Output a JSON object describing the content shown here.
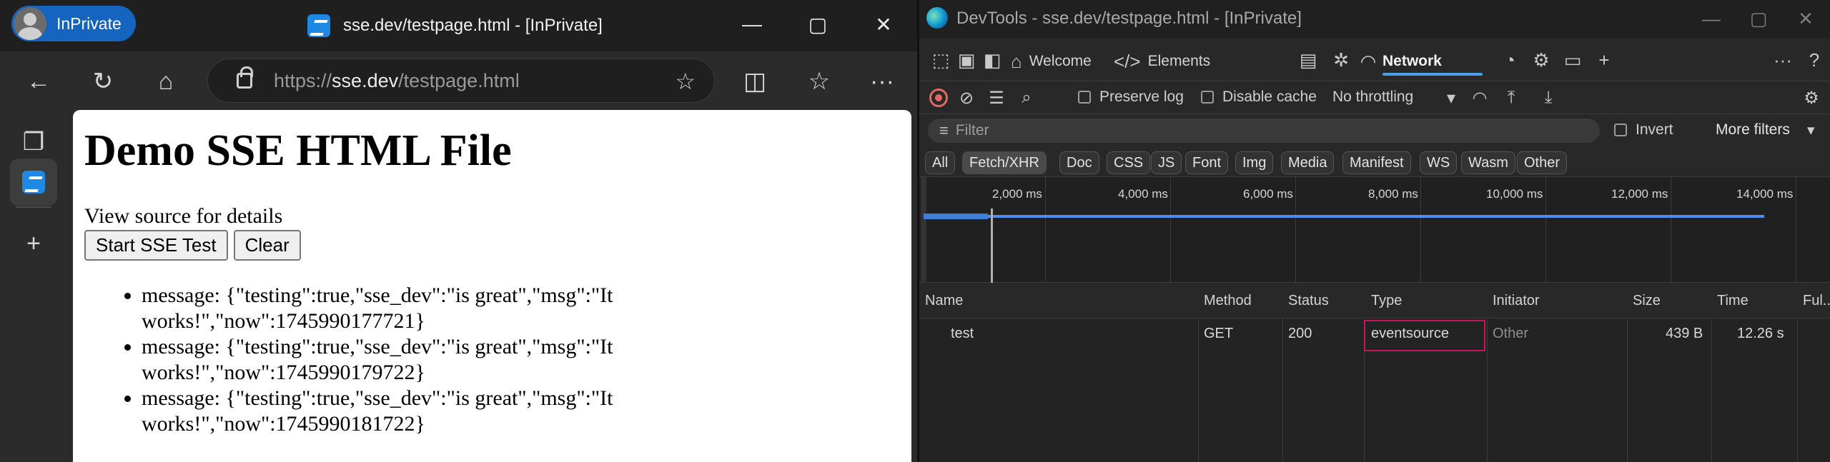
{
  "browser": {
    "profile_label": "InPrivate",
    "tab_title": "sse.dev/testpage.html - [InPrivate]",
    "window_controls": {
      "minimize": "—",
      "maximize": "▢",
      "close": "✕"
    },
    "toolbar": {
      "back_icon": "←",
      "refresh_icon": "↻",
      "home_icon": "⌂",
      "url_scheme": "https://",
      "url_host": "sse.dev",
      "url_path": "/testpage.html",
      "favorite_icon": "☆",
      "split_icon": "◫",
      "favorites_icon": "☆",
      "more_icon": "···"
    },
    "sidebar": {
      "tabs_icon": "❐",
      "add_icon": "+"
    }
  },
  "page": {
    "heading": "Demo SSE HTML File",
    "note": "View source for details",
    "start_button": "Start SSE Test",
    "clear_button": "Clear",
    "messages": [
      "message: {\"testing\":true,\"sse_dev\":\"is great\",\"msg\":\"It works!\",\"now\":1745990177721}",
      "message: {\"testing\":true,\"sse_dev\":\"is great\",\"msg\":\"It works!\",\"now\":1745990179722}",
      "message: {\"testing\":true,\"sse_dev\":\"is great\",\"msg\":\"It works!\",\"now\":1745990181722}"
    ]
  },
  "devtools": {
    "title": "DevTools - sse.dev/testpage.html - [InPrivate]",
    "window_controls": {
      "minimize": "—",
      "maximize": "▢",
      "close": "✕"
    },
    "tabs": {
      "welcome": "Welcome",
      "elements": "Elements",
      "network": "Network",
      "add": "+",
      "more": "···",
      "help": "?"
    },
    "network_toolbar": {
      "preserve_log": "Preserve log",
      "disable_cache": "Disable cache",
      "throttling": "No throttling"
    },
    "filter": {
      "placeholder": "Filter",
      "invert": "Invert",
      "more_filters": "More filters"
    },
    "type_filters": [
      "All",
      "Fetch/XHR",
      "Doc",
      "CSS",
      "JS",
      "Font",
      "Img",
      "Media",
      "Manifest",
      "WS",
      "Wasm",
      "Other"
    ],
    "selected_type": "Fetch/XHR",
    "overview_ticks": [
      "2,000 ms",
      "4,000 ms",
      "6,000 ms",
      "8,000 ms",
      "10,000 ms",
      "12,000 ms",
      "14,000 ms"
    ],
    "table": {
      "headers": [
        "Name",
        "Method",
        "Status",
        "Type",
        "Initiator",
        "Size",
        "Time",
        "Ful..."
      ],
      "rows": [
        {
          "name": "test",
          "method": "GET",
          "status": "200",
          "type": "eventsource",
          "initiator": "Other",
          "size": "439 B",
          "time": "12.26 s"
        }
      ]
    }
  },
  "colors": {
    "accent": "#4b9fe8",
    "inprivate": "#1565c0",
    "record": "#e46962",
    "highlight": "#c2185b"
  }
}
